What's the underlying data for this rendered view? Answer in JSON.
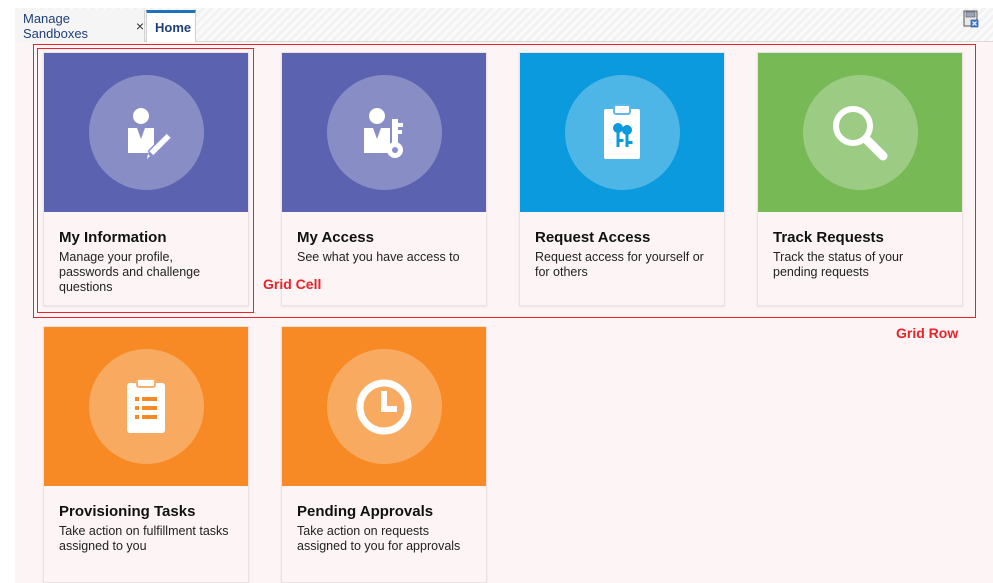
{
  "tabs": {
    "sandboxes_label": "Manage Sandboxes",
    "close_glyph": "×",
    "home_label": "Home"
  },
  "toolbar": {
    "icon": "save-icon"
  },
  "colors": {
    "purple": "#5b62b0",
    "blue": "#0b9add",
    "green": "#77b954",
    "orange": "#f78a24",
    "annotation_red": "#e8232a"
  },
  "cards": [
    {
      "title": "My Information",
      "description": "Manage your profile, passwords and challenge questions",
      "icon": "user-edit-icon",
      "color": "#5b62b0"
    },
    {
      "title": "My Access",
      "description": "See what you have access to",
      "icon": "user-key-icon",
      "color": "#5b62b0"
    },
    {
      "title": "Request Access",
      "description": "Request access for yourself or for others",
      "icon": "clipboard-keys-icon",
      "color": "#0b9add"
    },
    {
      "title": "Track Requests",
      "description": "Track the status of your pending requests",
      "icon": "magnifier-icon",
      "color": "#77b954"
    },
    {
      "title": "Provisioning Tasks",
      "description": "Take action on fulfillment tasks assigned to you",
      "icon": "task-list-icon",
      "color": "#f78a24"
    },
    {
      "title": "Pending Approvals",
      "description": "Take action on requests assigned to you for approvals",
      "icon": "clock-icon",
      "color": "#f78a24"
    }
  ],
  "annotations": {
    "grid_cell": "Grid Cell",
    "grid_row": "Grid Row"
  }
}
